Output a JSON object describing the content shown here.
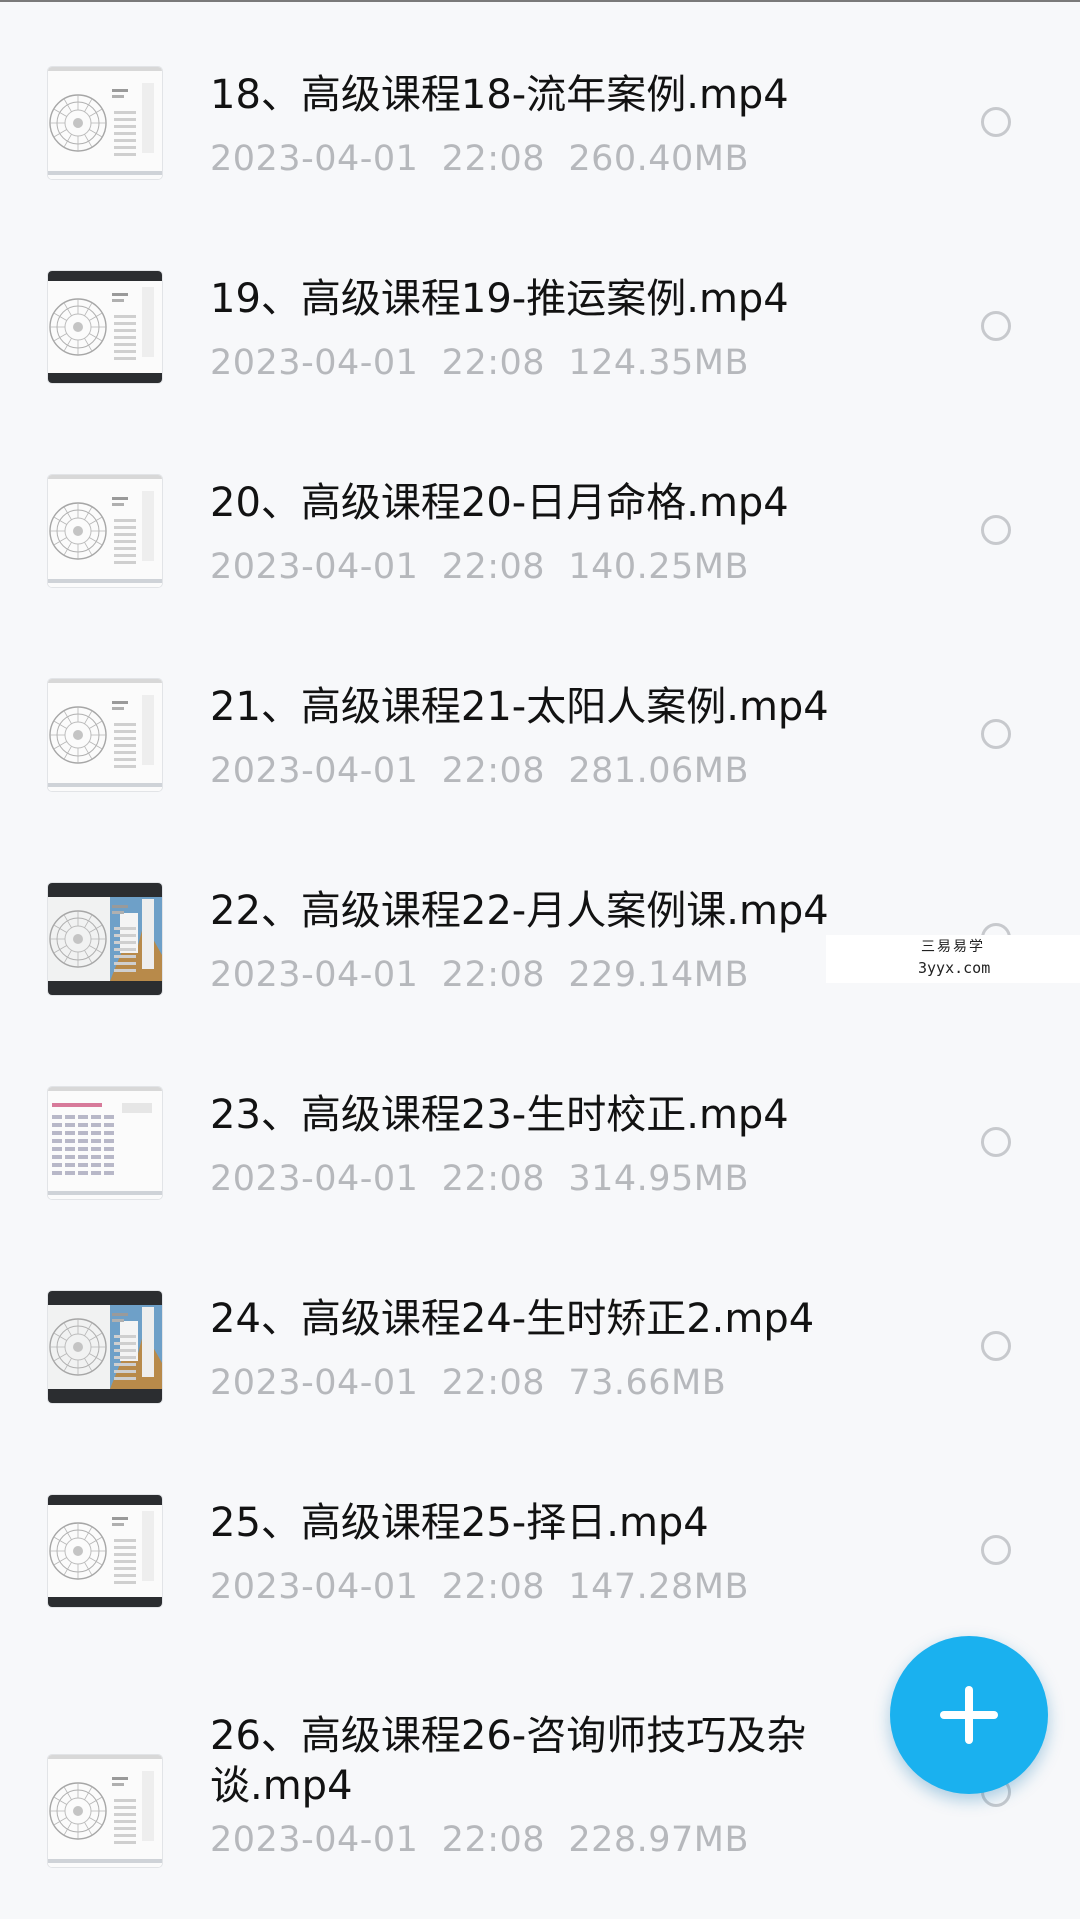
{
  "files": [
    {
      "name": "18、高级课程18-流年案例.mp4",
      "date": "2023-04-01",
      "time": "22:08",
      "size": "260.40MB",
      "thumbnail": "light"
    },
    {
      "name": "19、高级课程19-推运案例.mp4",
      "date": "2023-04-01",
      "time": "22:08",
      "size": "124.35MB",
      "thumbnail": "light-dark-bars"
    },
    {
      "name": "20、高级课程20-日月命格.mp4",
      "date": "2023-04-01",
      "time": "22:08",
      "size": "140.25MB",
      "thumbnail": "light"
    },
    {
      "name": "21、高级课程21-太阳人案例.mp4",
      "date": "2023-04-01",
      "time": "22:08",
      "size": "281.06MB",
      "thumbnail": "light"
    },
    {
      "name": "22、高级课程22-月人案例课.mp4",
      "date": "2023-04-01",
      "time": "22:08",
      "size": "229.14MB",
      "thumbnail": "dark-landscape"
    },
    {
      "name": "23、高级课程23-生时校正.mp4",
      "date": "2023-04-01",
      "time": "22:08",
      "size": "314.95MB",
      "thumbnail": "table"
    },
    {
      "name": "24、高级课程24-生时矫正2.mp4",
      "date": "2023-04-01",
      "time": "22:08",
      "size": "73.66MB",
      "thumbnail": "dark-landscape"
    },
    {
      "name": "25、高级课程25-择日.mp4",
      "date": "2023-04-01",
      "time": "22:08",
      "size": "147.28MB",
      "thumbnail": "light-dark-bars"
    },
    {
      "name": "26、高级课程26-咨询师技巧及杂谈.mp4",
      "date": "2023-04-01",
      "time": "22:08",
      "size": "228.97MB",
      "thumbnail": "light"
    }
  ],
  "watermark": {
    "line1": "三易易学",
    "line2": "3yyx.com"
  },
  "fab": {
    "icon": "plus-icon",
    "color": "#1ab1ef"
  },
  "colors": {
    "background": "#f7f8fa",
    "title": "#121212",
    "meta": "#b6b8bc",
    "radio": "#c7c9cd"
  }
}
